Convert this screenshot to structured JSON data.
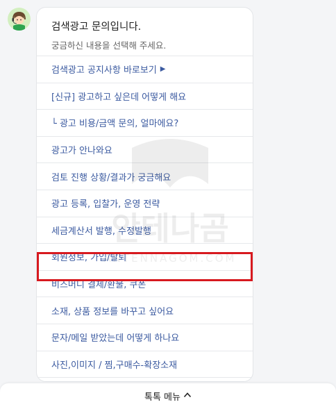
{
  "chat": {
    "title": "검색광고 문의입니다.",
    "subtitle": "궁금하신 내용을 선택해 주세요."
  },
  "menu": {
    "items": [
      {
        "label": "검색광고 공지사항 바로보기",
        "arrow": "▶"
      },
      {
        "label": "[신규] 광고하고 싶은데 어떻게 해요"
      },
      {
        "label": "└ 광고 비용/금액 문의, 얼마에요?"
      },
      {
        "label": "광고가 안나와요"
      },
      {
        "label": "검토 진행 상황/결과가 궁금해요"
      },
      {
        "label": "광고 등록, 입찰가, 운영 전략"
      },
      {
        "label": "세금계산서 발행, 수정발행"
      },
      {
        "label": "회원정보, 가입/탈퇴"
      },
      {
        "label": "비즈머니 결제/환불, 쿠폰"
      },
      {
        "label": "소재, 상품 정보를 바꾸고 싶어요"
      },
      {
        "label": "문자/메일 받았는데 어떻게 하나요"
      },
      {
        "label": "사진,이미지 / 찜,구매수-확장소재"
      }
    ]
  },
  "watermark": {
    "text": "안테나곰",
    "subtext": "ANTENNAGOM.COM"
  },
  "bottom_bar": {
    "label": "톡톡 메뉴"
  },
  "colors": {
    "link": "#3b5aa0",
    "highlight": "#d7191f"
  },
  "icons": {
    "avatar": "agent-avatar-icon",
    "chevron": "chevron-up-icon",
    "arrow": "triangle-right-icon"
  }
}
